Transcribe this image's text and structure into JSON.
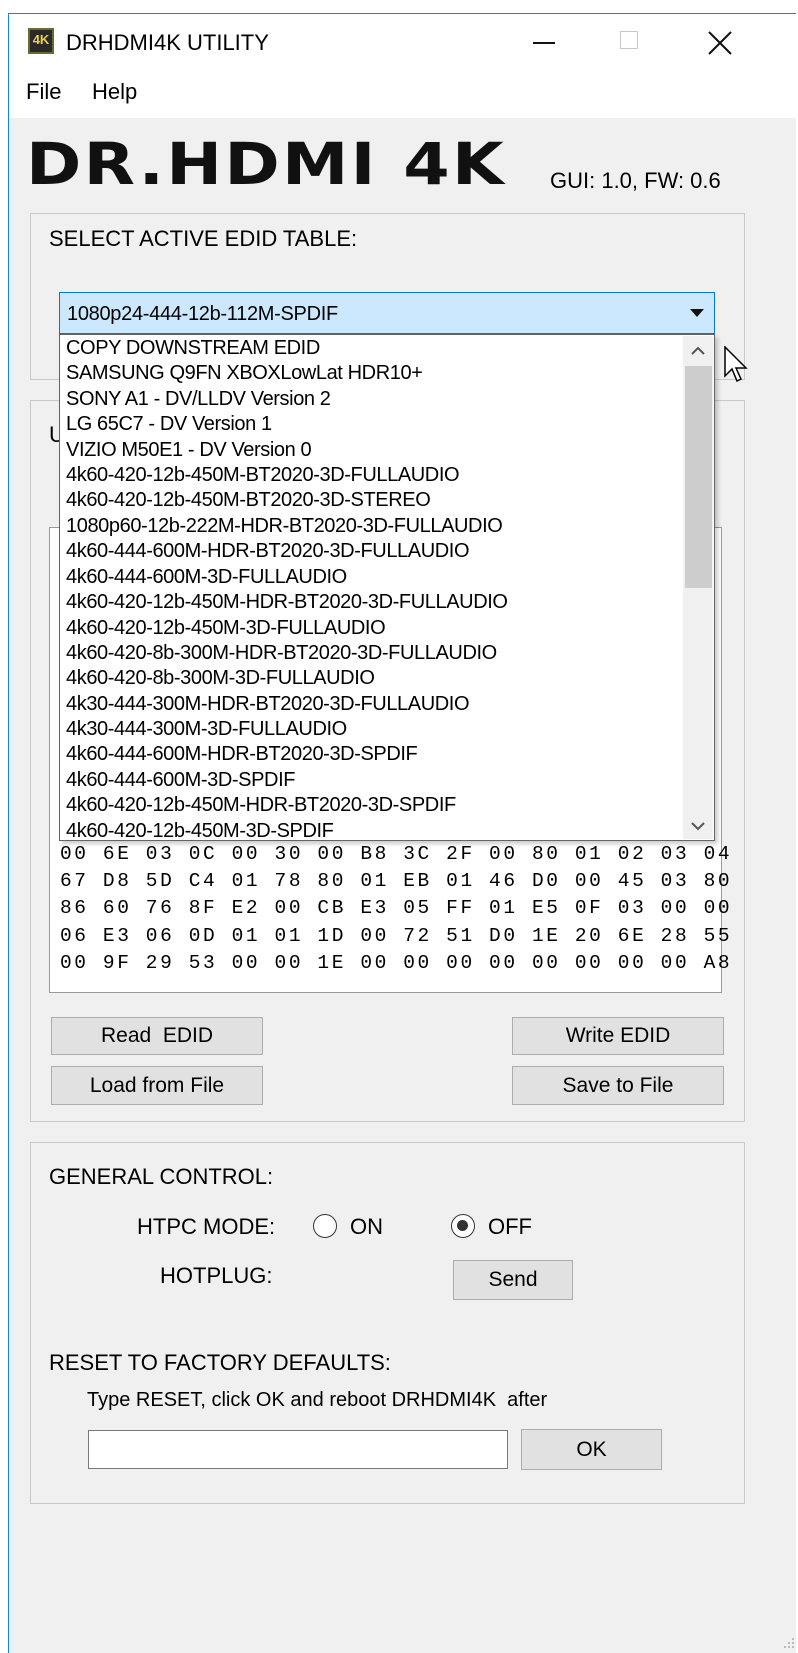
{
  "window": {
    "title": "DRHDMI4K UTILITY",
    "app_icon_label": "4K"
  },
  "menu": {
    "file": "File",
    "help": "Help"
  },
  "header": {
    "logo_text": "DR.HDMI 4K",
    "version": "GUI: 1.0, FW: 0.6"
  },
  "edid_select": {
    "label": "SELECT ACTIVE EDID TABLE:",
    "selected": "1080p24-444-12b-112M-SPDIF",
    "options": [
      "COPY DOWNSTREAM EDID",
      "SAMSUNG Q9FN XBOXLowLat HDR10+",
      "SONY A1 - DV/LLDV Version 2",
      "LG 65C7 - DV Version 1",
      "VIZIO M50E1 - DV Version 0",
      "4k60-420-12b-450M-BT2020-3D-FULLAUDIO",
      "4k60-420-12b-450M-BT2020-3D-STEREO",
      "1080p60-12b-222M-HDR-BT2020-3D-FULLAUDIO",
      "4k60-444-600M-HDR-BT2020-3D-FULLAUDIO",
      "4k60-444-600M-3D-FULLAUDIO",
      "4k60-420-12b-450M-HDR-BT2020-3D-FULLAUDIO",
      "4k60-420-12b-450M-3D-FULLAUDIO",
      "4k60-420-8b-300M-HDR-BT2020-3D-FULLAUDIO",
      "4k60-420-8b-300M-3D-FULLAUDIO",
      "4k30-444-300M-HDR-BT2020-3D-FULLAUDIO",
      "4k30-444-300M-3D-FULLAUDIO",
      "4k60-444-600M-HDR-BT2020-3D-SPDIF",
      "4k60-444-600M-3D-SPDIF",
      "4k60-420-12b-450M-HDR-BT2020-3D-SPDIF",
      "4k60-420-12b-450M-3D-SPDIF"
    ]
  },
  "edid_group": {
    "label_fragment": "U",
    "hex_lines": [
      "00 6E 03 0C 00 30 00 B8 3C 2F 00 80 01 02 03 04",
      "67 D8 5D C4 01 78 80 01 EB 01 46 D0 00 45 03 80",
      "86 60 76 8F E2 00 CB E3 05 FF 01 E5 0F 03 00 00",
      "06 E3 06 0D 01 01 1D 00 72 51 D0 1E 20 6E 28 55",
      "00 9F 29 53 00 00 1E 00 00 00 00 00 00 00 00 A8"
    ],
    "read_button": "Read  EDID",
    "write_button": "Write EDID",
    "load_button": "Load from File",
    "save_button": "Save to File"
  },
  "general": {
    "label": "GENERAL CONTROL:",
    "htpc_label": "HTPC MODE:",
    "on_label": "ON",
    "off_label": "OFF",
    "htpc_selected": "OFF",
    "hotplug_label": "HOTPLUG:",
    "send_button": "Send",
    "reset_label": "RESET TO FACTORY DEFAULTS:",
    "reset_hint": "Type RESET, click OK and reboot DRHDMI4K  after",
    "reset_input_value": "",
    "ok_button": "OK"
  },
  "colors": {
    "accent_border": "#1883d7",
    "selection": "#cce8ff",
    "window_bg": "#f0f0f0"
  }
}
